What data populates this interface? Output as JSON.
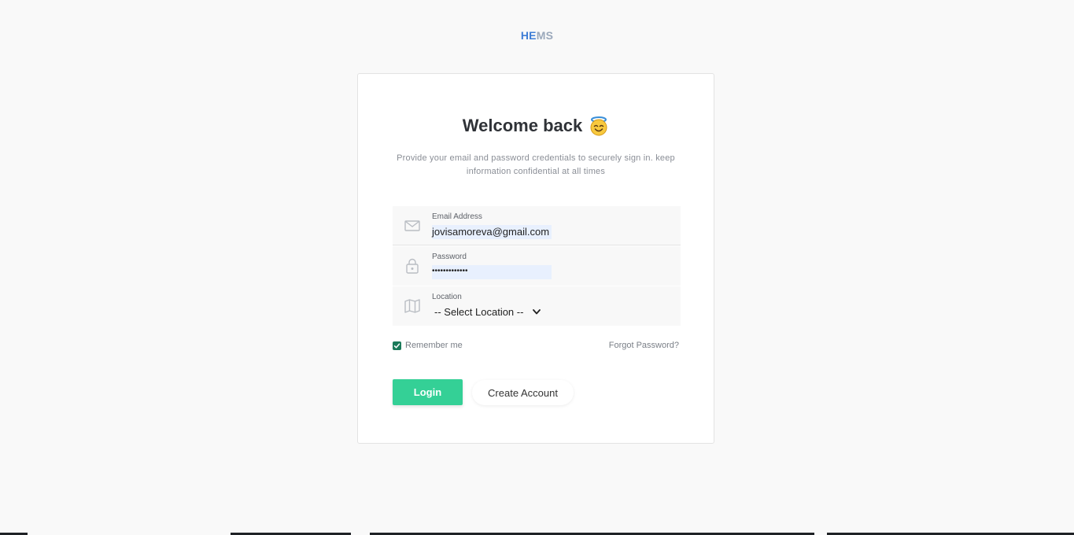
{
  "brand": {
    "part1": "HE",
    "part2": "MS"
  },
  "login": {
    "title": "Welcome back",
    "title_emoji": "smiling-face-with-halo",
    "subtitle": "Provide your email and password credentials to securely sign in. keep information confidential at all times",
    "email": {
      "label": "Email Address",
      "value": "jovisamoreva@gmail.com",
      "icon": "mail-icon"
    },
    "password": {
      "label": "Password",
      "value": "•••••••••••••",
      "icon": "lock-icon"
    },
    "location": {
      "label": "Location",
      "value": "-- Select Location --",
      "icon": "map-icon"
    },
    "remember_label": "Remember me",
    "remember_checked": true,
    "forgot_label": "Forgot Password?",
    "login_label": "Login",
    "create_label": "Create Account"
  },
  "colors": {
    "accent": "#34d096",
    "brand_blue": "#3f7ed6",
    "brand_gray": "#9aa8bb",
    "checkbox": "#1a7a5a"
  }
}
